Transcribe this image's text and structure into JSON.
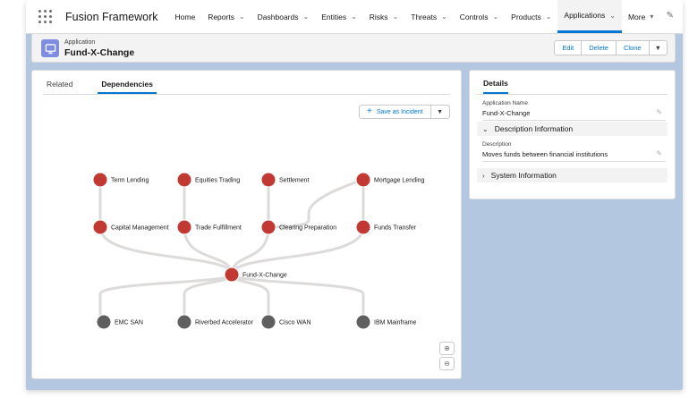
{
  "nav": {
    "app_name": "Fusion Framework",
    "items": [
      {
        "label": "Home",
        "has_menu": false,
        "active": false
      },
      {
        "label": "Reports",
        "has_menu": true,
        "active": false
      },
      {
        "label": "Dashboards",
        "has_menu": true,
        "active": false
      },
      {
        "label": "Entities",
        "has_menu": true,
        "active": false
      },
      {
        "label": "Risks",
        "has_menu": true,
        "active": false
      },
      {
        "label": "Threats",
        "has_menu": true,
        "active": false
      },
      {
        "label": "Controls",
        "has_menu": true,
        "active": false
      },
      {
        "label": "Products",
        "has_menu": true,
        "active": false
      },
      {
        "label": "Applications",
        "has_menu": true,
        "active": true
      },
      {
        "label": "More",
        "has_menu": true,
        "active": false
      }
    ]
  },
  "header": {
    "object_type": "Application",
    "record_name": "Fund-X-Change",
    "buttons": {
      "edit": "Edit",
      "delete": "Delete",
      "clone": "Clone"
    }
  },
  "tabs": [
    {
      "label": "Related",
      "active": false
    },
    {
      "label": "Dependencies",
      "active": true
    }
  ],
  "incident": {
    "label": "Save as Incident"
  },
  "graph": {
    "center": "Fund-X-Change",
    "upstream_top": [
      "Term Lending",
      "Equities Trading",
      "Settlement",
      "Mortgage Lending"
    ],
    "upstream_mid": [
      "Capital Management",
      "Trade Fulfillment",
      "Clearing Preparation",
      "Funds Transfer"
    ],
    "downstream": [
      "EMC SAN",
      "Riverbed Accelerator",
      "Cisco WAN",
      "IBM Mainframe"
    ],
    "colors": {
      "upstream": "#c23934",
      "downstream": "#5f5f5f",
      "edge": "#dddbda"
    }
  },
  "details": {
    "title": "Details",
    "application_name_label": "Application Name",
    "application_name_value": "Fund-X-Change",
    "description_section": "Description Information",
    "description_label": "Description",
    "description_value": "Moves funds between financial institutions",
    "system_section": "System Information"
  },
  "colors": {
    "brand": "#0176d3",
    "app_icon": "#7f8de1",
    "background": "#b3c8e0"
  }
}
